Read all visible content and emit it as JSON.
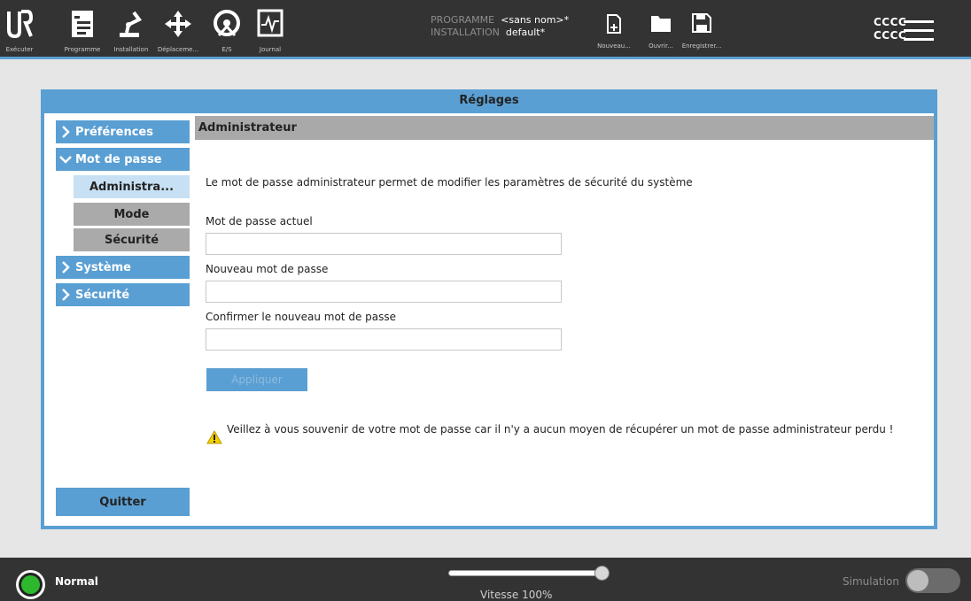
{
  "topbar": {
    "nav": [
      {
        "label": "Exécuter",
        "icon": "ur-logo-icon"
      },
      {
        "label": "Programme",
        "icon": "program-icon"
      },
      {
        "label": "Installation",
        "icon": "robot-arm-icon"
      },
      {
        "label": "Déplaceme...",
        "icon": "move-icon"
      },
      {
        "label": "E/S",
        "icon": "io-icon"
      },
      {
        "label": "Journal",
        "icon": "log-icon"
      }
    ],
    "program_label": "PROGRAMME",
    "program_value": "<sans nom>*",
    "installation_label": "INSTALLATION",
    "installation_value": "default*",
    "file_actions": [
      {
        "label": "Nouveau...",
        "icon": "new-file-icon"
      },
      {
        "label": "Ouvrir...",
        "icon": "open-folder-icon"
      },
      {
        "label": "Enregistrer...",
        "icon": "save-icon"
      }
    ],
    "id_line1": "CCCC",
    "id_line2": "CCCC",
    "menu_icon": "hamburger-menu-icon"
  },
  "dialog": {
    "title": "Réglages",
    "sidebar": {
      "items": [
        {
          "label": "Préférences",
          "icon": "chevron-right-icon"
        },
        {
          "label": "Mot de passe",
          "icon": "chevron-down-icon"
        },
        {
          "label": "Système",
          "icon": "chevron-right-icon"
        },
        {
          "label": "Sécurité",
          "icon": "chevron-right-icon"
        }
      ],
      "sub_items": [
        {
          "label": "Administra...",
          "active": true
        },
        {
          "label": "Mode",
          "active": false
        },
        {
          "label": "Sécurité",
          "active": false
        }
      ],
      "quit_label": "Quitter"
    },
    "content": {
      "header": "Administrateur",
      "description": "Le mot de passe administrateur permet de modifier les paramètres de sécurité du système",
      "fields": [
        {
          "label": "Mot de passe actuel",
          "value": ""
        },
        {
          "label": "Nouveau mot de passe",
          "value": ""
        },
        {
          "label": "Confirmer le nouveau mot de passe",
          "value": ""
        }
      ],
      "apply_label": "Appliquer",
      "warning": "Veillez à vous souvenir de votre mot de passe car il n'y a aucun moyen de récupérer un mot de passe administrateur perdu !",
      "warning_icon": "warning-icon"
    }
  },
  "bottombar": {
    "status": "Normal",
    "status_color": "#2db82d",
    "speed_fraction": 1.0,
    "speed_label": "Vitesse 100%",
    "simulation_label": "Simulation",
    "simulation_on": false
  },
  "colors": {
    "accent": "#5a9fd3",
    "bar": "#333333",
    "sub_item": "#aaaaaa",
    "sub_item_active": "#c7e0f3"
  }
}
